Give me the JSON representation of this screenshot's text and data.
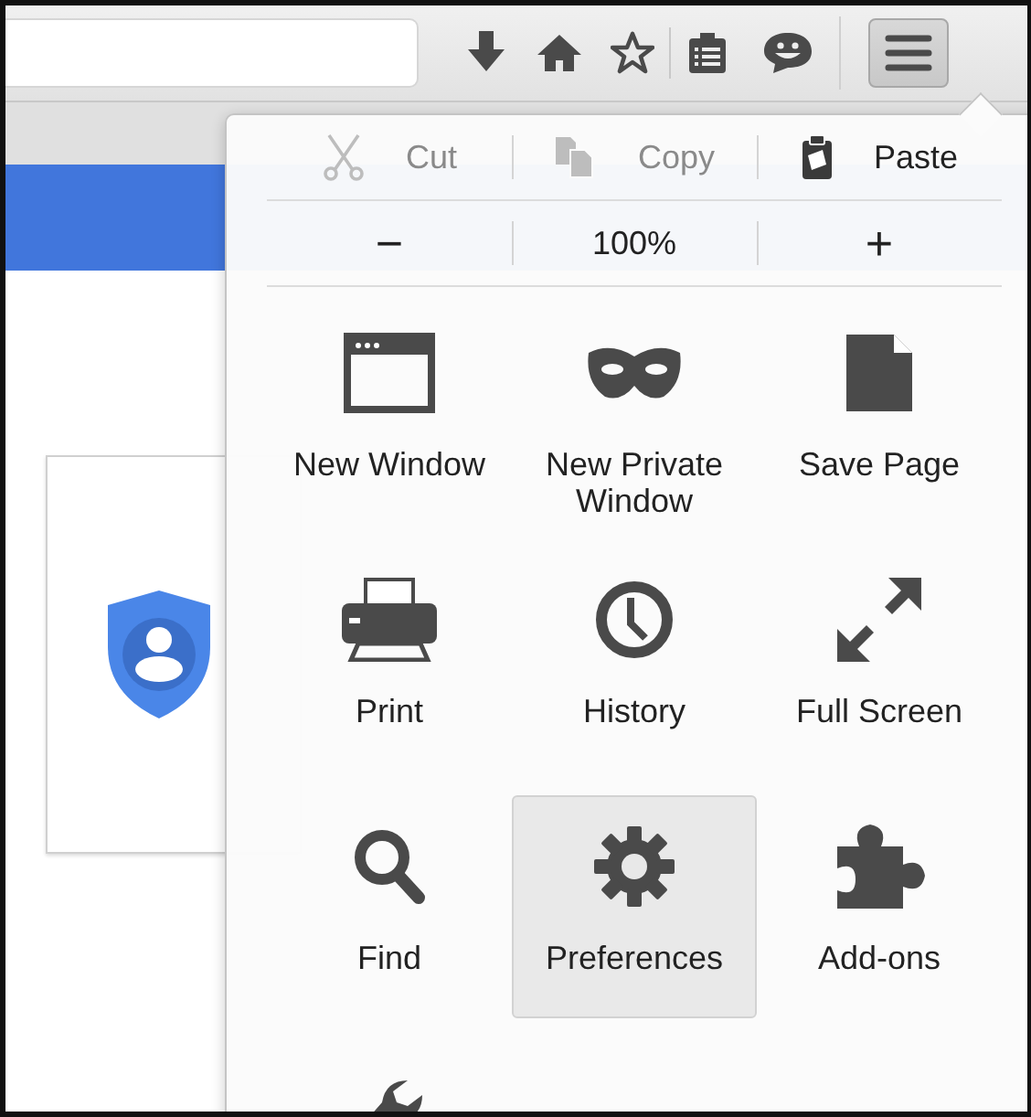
{
  "edit_buttons": [
    {
      "kind": "cut",
      "label": "Cut",
      "disabled": true
    },
    {
      "kind": "copy",
      "label": "Copy",
      "disabled": true
    },
    {
      "kind": "paste",
      "label": "Paste",
      "disabled": false
    }
  ],
  "zoom": {
    "minus": "−",
    "level": "100%",
    "plus": "+"
  },
  "items": [
    {
      "kind": "new-window",
      "label": "New Window",
      "selected": false
    },
    {
      "kind": "private",
      "label": "New Private Window",
      "selected": false
    },
    {
      "kind": "save",
      "label": "Save Page",
      "selected": false
    },
    {
      "kind": "print",
      "label": "Print",
      "selected": false
    },
    {
      "kind": "history",
      "label": "History",
      "selected": false
    },
    {
      "kind": "fullscreen",
      "label": "Full Screen",
      "selected": false
    },
    {
      "kind": "find",
      "label": "Find",
      "selected": false
    },
    {
      "kind": "preferences",
      "label": "Preferences",
      "selected": true
    },
    {
      "kind": "addons",
      "label": "Add-ons",
      "selected": false
    },
    {
      "kind": "customize",
      "selected": false
    }
  ]
}
